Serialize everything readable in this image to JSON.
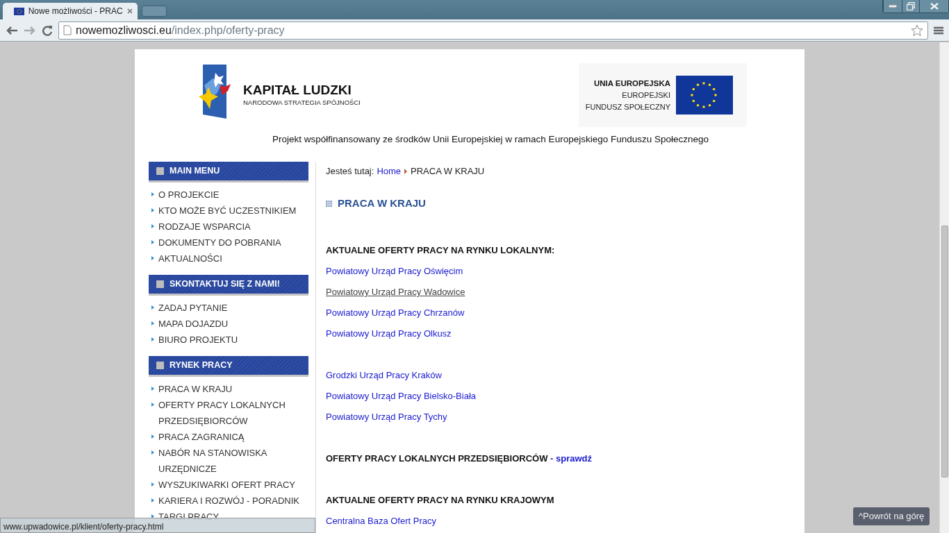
{
  "browser": {
    "tab_title": "Nowe możliwości - PRAC",
    "url_host": "nowemozliwosci.eu",
    "url_path": "/index.php/oferty-pracy"
  },
  "header": {
    "logo_left": {
      "title": "KAPITAŁ LUDZKI",
      "subtitle": "NARODOWA STRATEGIA SPÓJNOŚCI"
    },
    "logo_right": {
      "title": "UNIA EUROPEJSKA",
      "line_1": "EUROPEJSKI",
      "line_2": "FUNDUSZ SPOŁECZNY"
    },
    "caption": "Projekt współfinansowany ze środków Unii Europejskiej w ramach Europejskiego Funduszu Społecznego"
  },
  "sidebar": {
    "sections": [
      {
        "title": "MAIN MENU",
        "items": [
          "O PROJEKCIE",
          "KTO MOŻE BYĆ UCZESTNIKIEM",
          "RODZAJE WSPARCIA",
          "DOKUMENTY DO POBRANIA",
          "AKTUALNOŚCI"
        ]
      },
      {
        "title": "SKONTAKTUJ SIĘ Z NAMI!",
        "items": [
          "ZADAJ PYTANIE",
          "MAPA DOJAZDU",
          "BIURO PROJEKTU"
        ]
      },
      {
        "title": "RYNEK PRACY",
        "items": [
          "PRACA W KRAJU",
          "OFERTY PRACY LOKALNYCH PRZEDSIĘBIORCÓW",
          "PRACA ZAGRANICĄ",
          "NABÓR NA STANOWISKA URZĘDNICZE",
          "WYSZUKIWARKI OFERT PRACY",
          "KARIERA I ROZWÓJ - PORADNIK",
          "TARGI PRACY"
        ]
      }
    ]
  },
  "breadcrumb": {
    "label": "Jesteś tutaj:",
    "links": [
      "Home"
    ],
    "current": "PRACA W KRAJU"
  },
  "content": {
    "heading": "PRACA W KRAJU",
    "groups": [
      {
        "heading": "AKTUALNE OFERTY PRACY NA RYNKU LOKALNYM:",
        "links": [
          {
            "text": "Powiatowy Urząd Pracy Oświęcim",
            "hovered": false
          },
          {
            "text": "Powiatowy Urząd Pracy Wadowice",
            "hovered": true
          },
          {
            "text": "Powiatowy Urząd Pracy Chrzanów",
            "hovered": false
          },
          {
            "text": "Powiatowy Urząd Pracy Olkusz",
            "hovered": false
          }
        ]
      },
      {
        "links": [
          {
            "text": "Grodzki Urząd Pracy Kraków",
            "hovered": false
          },
          {
            "text": "Powiatowy Urząd Pracy Bielsko-Biała",
            "hovered": false
          },
          {
            "text": "Powiatowy Urząd Pracy Tychy",
            "hovered": false
          }
        ]
      },
      {
        "heading": "OFERTY PRACY LOKALNYCH PRZEDSIĘBIORCÓW",
        "heading_link": "- sprawdź"
      },
      {
        "heading": "AKTUALNE OFERTY PRACY NA RYNKU KRAJOWYM",
        "links": [
          {
            "text": "Centralna Baza Ofert Pracy",
            "hovered": false
          }
        ]
      }
    ]
  },
  "status_bar": "www.upwadowice.pl/klient/oferty-pracy.html",
  "back_to_top": "^Powrót na górę"
}
